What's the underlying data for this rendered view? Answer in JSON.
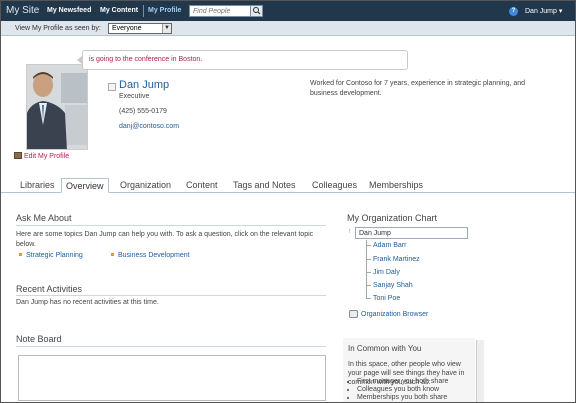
{
  "topbar": {
    "site": "My Site",
    "nav": [
      "My Newsfeed",
      "My Content",
      "My Profile"
    ],
    "search_placeholder": "Find People",
    "user": "Dan Jump ▾"
  },
  "viewbar": {
    "label": "View My Profile as seen by:",
    "selected": "Everyone"
  },
  "profile": {
    "status": "is going to the conference in Boston.",
    "name": "Dan Jump",
    "title": "Executive",
    "phone": "(425) 555-0179",
    "email": "danj@contoso.com",
    "about": "Worked for Contoso for 7 years, experience in strategic planning, and business development.",
    "edit": "Edit My Profile"
  },
  "tabs": [
    "Libraries",
    "Overview",
    "Organization",
    "Content",
    "Tags and Notes",
    "Colleagues",
    "Memberships"
  ],
  "active_tab": "Overview",
  "ask": {
    "heading": "Ask Me About",
    "intro": "Here are some topics Dan Jump can help you with. To ask a question, click on the relevant topic below.",
    "topics": [
      "Strategic Planning",
      "Business Development"
    ]
  },
  "recent": {
    "heading": "Recent Activities",
    "text": "Dan Jump has no recent activities at this time."
  },
  "noteboard": {
    "heading": "Note Board"
  },
  "org": {
    "heading": "My Organization Chart",
    "self": "Dan Jump",
    "reports": [
      "Adam Barr",
      "Frank Martinez",
      "Jim Daly",
      "Sanjay Shah",
      "Toni Poe"
    ],
    "browser": "Organization Browser"
  },
  "common": {
    "heading": "In Common with You",
    "text": "In this space, other people who view your page will see things they have in common with you such as:",
    "items": [
      "First manager you both share",
      "Colleagues you both know",
      "Memberships you both share"
    ]
  },
  "colors": {
    "topbar": "#21374c",
    "link": "#1f5c9a",
    "accent": "#b22050"
  }
}
